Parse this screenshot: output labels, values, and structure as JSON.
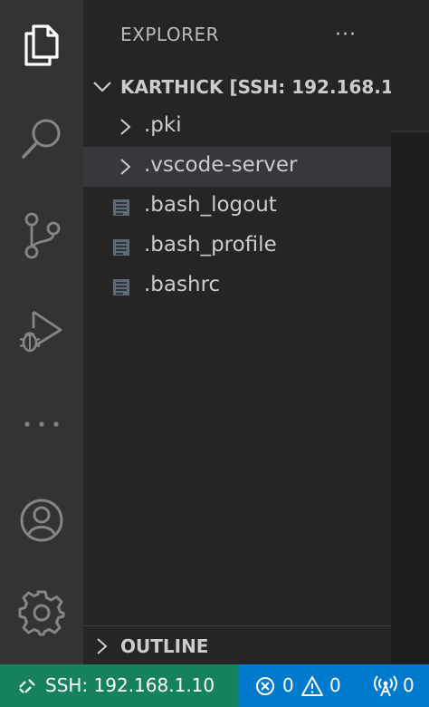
{
  "activity_bar": {
    "items": [
      {
        "id": "explorer",
        "icon": "files-icon"
      },
      {
        "id": "search",
        "icon": "search-icon"
      },
      {
        "id": "source-control",
        "icon": "source-control-icon"
      },
      {
        "id": "run-debug",
        "icon": "run-debug-icon"
      },
      {
        "id": "more",
        "icon": "ellipsis-icon"
      },
      {
        "id": "accounts",
        "icon": "account-icon"
      },
      {
        "id": "manage",
        "icon": "gear-icon"
      }
    ]
  },
  "sidebar": {
    "title": "EXPLORER",
    "more_actions": "···",
    "folder": {
      "title": "KARTHICK [SSH: 192.168.1...",
      "expanded": true
    },
    "tree": [
      {
        "label": ".pki",
        "type": "folder",
        "selected": false
      },
      {
        "label": ".vscode-server",
        "type": "folder",
        "selected": true
      },
      {
        "label": ".bash_logout",
        "type": "file",
        "selected": false
      },
      {
        "label": ".bash_profile",
        "type": "file",
        "selected": false
      },
      {
        "label": ".bashrc",
        "type": "file",
        "selected": false
      }
    ],
    "outline": {
      "title": "OUTLINE"
    }
  },
  "status_bar": {
    "remote": "SSH: 192.168.1.10",
    "errors": "0",
    "warnings": "0",
    "ports": "0"
  },
  "colors": {
    "activity_bar_bg": "#333333",
    "sidebar_bg": "#252526",
    "selected_row_bg": "#37373d",
    "status_bar_bg": "#007acc",
    "remote_indicator_bg": "#16825d"
  }
}
